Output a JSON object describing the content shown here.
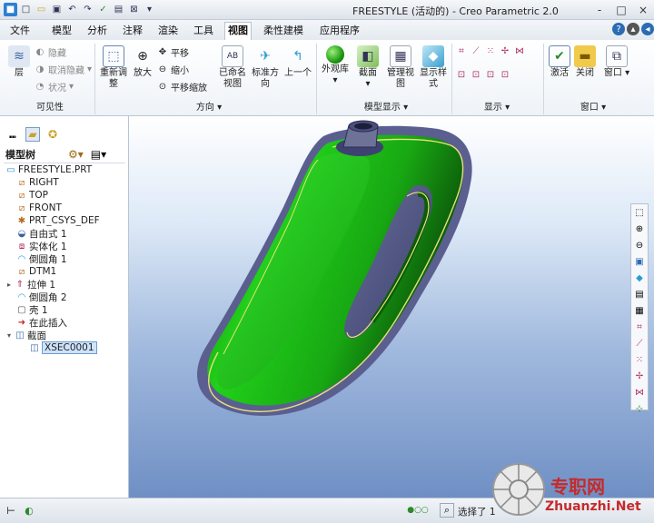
{
  "window": {
    "title": "FREESTYLE (活动的) - Creo Parametric 2.0",
    "controls": [
      "-",
      "□",
      "×"
    ]
  },
  "quick_access": [
    "new-icon",
    "open-icon",
    "save-icon",
    "undo-icon",
    "redo-icon",
    "regenerate-icon",
    "window-icon",
    "close-icon",
    "more-icon"
  ],
  "menu_tabs": [
    {
      "label": "文件",
      "active": false
    },
    {
      "label": "模型",
      "active": false
    },
    {
      "label": "分析",
      "active": false
    },
    {
      "label": "注释",
      "active": false
    },
    {
      "label": "渲染",
      "active": false
    },
    {
      "label": "工具",
      "active": false
    },
    {
      "label": "视图",
      "active": true
    },
    {
      "label": "柔性建模",
      "active": false
    },
    {
      "label": "应用程序",
      "active": false
    }
  ],
  "ribbon": {
    "visibility": {
      "label": "可见性",
      "layer": "层",
      "hide": "隐藏",
      "unhide": "取消隐藏",
      "status": "状况"
    },
    "orientation": {
      "label": "方向",
      "refit_line1": "重新调",
      "refit_line2": "整",
      "zoom_in": "放大",
      "pan": "平移",
      "zoom_out": "缩小",
      "pan_zoom": "平移缩放",
      "named_views_line1": "已命名",
      "named_views_line2": "视图",
      "standard_line1": "标准方",
      "standard_line2": "向",
      "previous": "上一个"
    },
    "model_display": {
      "label": "模型显示",
      "appearance": "外观库",
      "section": "截面",
      "manage_line1": "管理视",
      "manage_line2": "图",
      "display_style_line1": "显示样",
      "display_style_line2": "式"
    },
    "show": {
      "label": "显示"
    },
    "window": {
      "label": "窗口",
      "activate": "激活",
      "close": "关闭",
      "windows": "窗口"
    }
  },
  "model_tree": {
    "title": "模型树",
    "nodes": [
      {
        "label": "FREESTYLE.PRT",
        "icon": "part-icon",
        "expander": ""
      },
      {
        "label": "RIGHT",
        "icon": "datum-plane-icon",
        "expander": ""
      },
      {
        "label": "TOP",
        "icon": "datum-plane-icon",
        "expander": ""
      },
      {
        "label": "FRONT",
        "icon": "datum-plane-icon",
        "expander": ""
      },
      {
        "label": "PRT_CSYS_DEF",
        "icon": "csys-icon",
        "expander": ""
      },
      {
        "label": "自由式 1",
        "icon": "freestyle-icon",
        "expander": ""
      },
      {
        "label": "实体化 1",
        "icon": "solidify-icon",
        "expander": ""
      },
      {
        "label": "倒圆角 1",
        "icon": "round-icon",
        "expander": ""
      },
      {
        "label": "DTM1",
        "icon": "datum-plane-icon",
        "expander": ""
      },
      {
        "label": "拉伸 1",
        "icon": "extrude-icon",
        "expander": "▸"
      },
      {
        "label": "倒圆角 2",
        "icon": "round-icon",
        "expander": ""
      },
      {
        "label": "壳 1",
        "icon": "shell-icon",
        "expander": ""
      },
      {
        "label": "在此插入",
        "icon": "insert-here-icon",
        "expander": ""
      },
      {
        "label": "截面",
        "icon": "sections-icon",
        "expander": "▾"
      },
      {
        "label": "XSEC0001",
        "icon": "xsection-icon",
        "expander": "",
        "selected": true
      }
    ]
  },
  "status": {
    "select_label": "选择了 1"
  },
  "watermark": {
    "text": "专职网",
    "url": "Zhuanzhi.Net"
  },
  "colors": {
    "model_green": "#21d11a",
    "model_dark_green": "#0c5c0a",
    "model_rim": "#5b5f8f",
    "section_line": "#e8e07a",
    "selection": "#cde3fb",
    "watermark_red": "#c62a2a"
  }
}
